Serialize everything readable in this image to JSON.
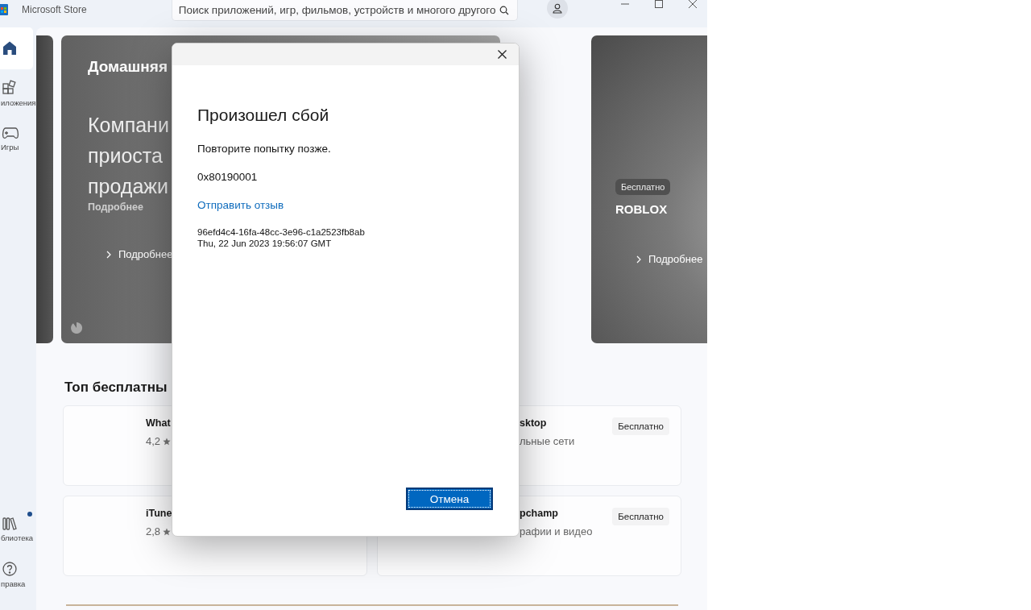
{
  "window": {
    "title": "Microsoft Store"
  },
  "search": {
    "placeholder": "Поиск приложений, игр, фильмов, устройств и многого другого"
  },
  "sidebar": {
    "items": [
      {
        "kind": "home",
        "selected": true
      },
      {
        "kind": "apps",
        "label": "иложения",
        "selected": false
      },
      {
        "kind": "games",
        "label": "Игры",
        "selected": false
      }
    ],
    "bottom_items": [
      {
        "kind": "library",
        "label": "блиотека",
        "selected": false,
        "badge": true
      },
      {
        "kind": "help",
        "label": "правка",
        "selected": false,
        "badge": false
      }
    ]
  },
  "hero": {
    "cards": [
      {
        "kind": "edge"
      },
      {
        "kind": "main",
        "eyebrow": "Домашняя",
        "headline": [
          "Компани",
          "приоста",
          "продажи"
        ],
        "sub": "Подробнее",
        "link": "Подробнее"
      },
      {
        "kind": "promo",
        "badge": "Бесплатно",
        "title": "ROBLOX",
        "link": "Подробнее"
      }
    ]
  },
  "section": {
    "title": "Топ бесплатны",
    "apps": [
      {
        "name": "What",
        "rating": "4,2"
      },
      {
        "name": "sktop",
        "category": "льные сети",
        "price": "Бесплатно"
      },
      {
        "name": "iTune",
        "rating": "2,8"
      },
      {
        "name": "pchamp",
        "category": "рафии и видео",
        "price": "Бесплатно"
      }
    ]
  },
  "dialog": {
    "title": "Произошел сбой",
    "message": "Повторите попытку позже.",
    "code": "0x80190001",
    "link": "Отправить отзыв",
    "details": [
      "96efd4c4-16fa-48cc-3e96-c1a2523fb8ab",
      "Thu, 22 Jun 2023 19:56:07 GMT"
    ],
    "button": "Отмена"
  }
}
